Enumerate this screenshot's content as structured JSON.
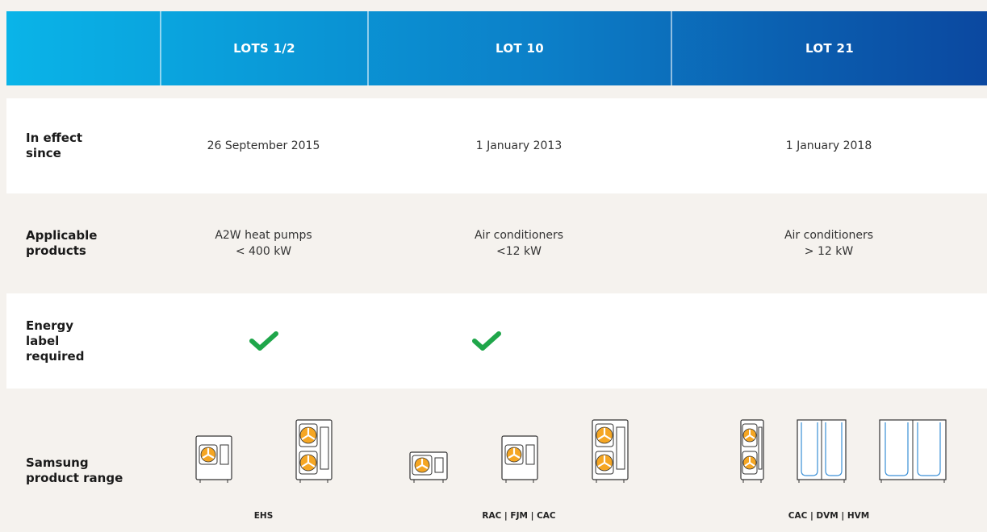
{
  "header": {
    "columns": [
      "LOTS 1/2",
      "LOT 10",
      "LOT 21"
    ]
  },
  "rows": {
    "in_effect": {
      "label": "In effect since",
      "values": [
        "26 September 2015",
        "1 January 2013",
        "1 January 2018"
      ]
    },
    "applicable": {
      "label": "Applicable products",
      "values": [
        "A2W heat pumps\n< 400 kW",
        "Air conditioners\n<12 kW",
        "Air conditioners\n> 12 kW"
      ]
    },
    "energy_label": {
      "label": "Energy label required",
      "required": [
        true,
        true,
        false
      ],
      "check_color": "#1fa64a"
    },
    "product_range": {
      "label": "Samsung product range",
      "captions": [
        "EHS",
        "RAC | FJM | CAC",
        "CAC | DVM | HVM"
      ],
      "units": [
        [
          "single-fan-outdoor-unit-icon",
          "double-fan-outdoor-unit-icon"
        ],
        [
          "compact-outdoor-unit-icon",
          "single-fan-outdoor-unit-icon",
          "double-fan-outdoor-unit-icon"
        ],
        [
          "double-fan-outdoor-unit-icon",
          "vrf-outdoor-unit-icon",
          "vrf-outdoor-unit-icon"
        ]
      ]
    }
  },
  "colors": {
    "header_start": "#0ab4e8",
    "header_end": "#0b48a0",
    "fan_orange": "#f5a623",
    "vrf_blue": "#3a8fd6"
  }
}
